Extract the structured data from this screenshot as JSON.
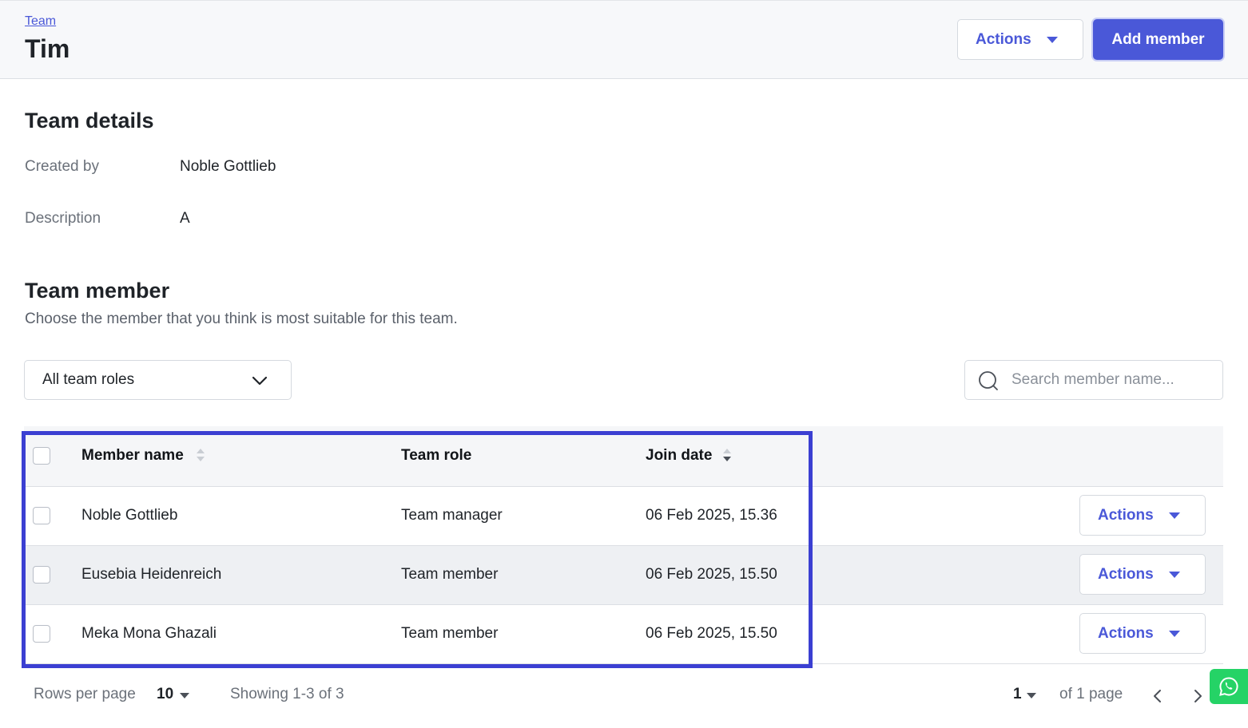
{
  "header": {
    "breadcrumb": "Team",
    "title": "Tim",
    "actions_label": "Actions",
    "add_member_label": "Add member"
  },
  "team_details": {
    "heading": "Team details",
    "created_by_label": "Created by",
    "created_by_value": "Noble Gottlieb",
    "description_label": "Description",
    "description_value": "A"
  },
  "team_member": {
    "heading": "Team member",
    "subtitle": "Choose the member that you think is most suitable for this team.",
    "role_filter": "All team roles",
    "search_placeholder": "Search member name..."
  },
  "table": {
    "columns": [
      "Member name",
      "Team role",
      "Join date"
    ],
    "rows": [
      {
        "name": "Noble Gottlieb",
        "role": "Team manager",
        "joined": "06 Feb 2025, 15.36",
        "action": "Actions"
      },
      {
        "name": "Eusebia Heidenreich",
        "role": "Team member",
        "joined": "06 Feb 2025, 15.50",
        "action": "Actions"
      },
      {
        "name": "Meka Mona Ghazali",
        "role": "Team member",
        "joined": "06 Feb 2025, 15.50",
        "action": "Actions"
      }
    ]
  },
  "pagination": {
    "rows_per_page_label": "Rows per page",
    "rows_per_page_value": "10",
    "showing": "Showing 1-3 of 3",
    "current_page": "1",
    "of_pages": "of 1 page"
  },
  "colors": {
    "accent": "#4a58d8",
    "highlight_border": "#3b3fd2",
    "whatsapp": "#25d366"
  },
  "icons": {
    "search": "search-icon",
    "chevron": "chevron-down-icon",
    "sort": "sort-icon",
    "whatsapp": "whatsapp-icon"
  }
}
